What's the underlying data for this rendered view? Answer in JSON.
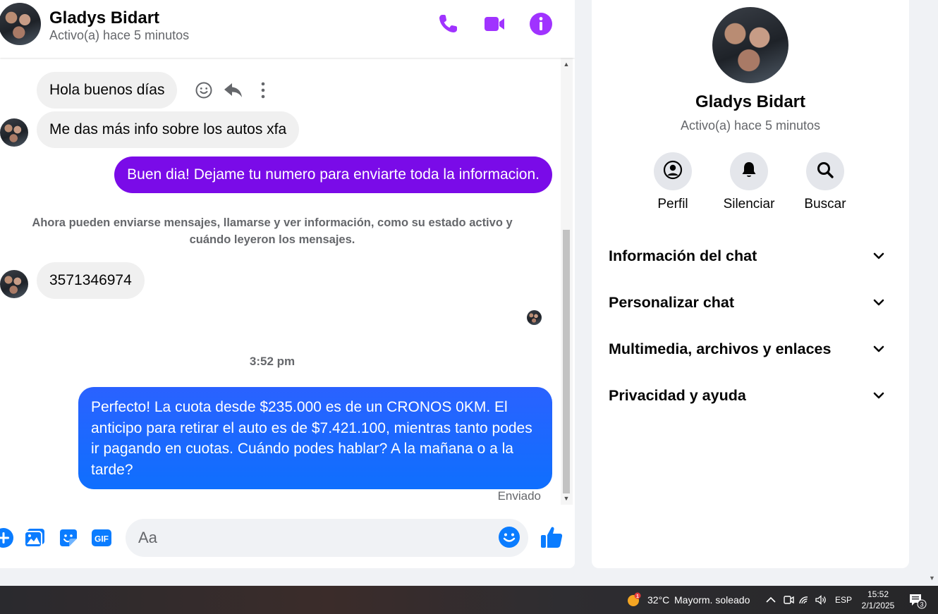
{
  "header": {
    "name": "Gladys Bidart",
    "status": "Activo(a) hace 5 minutos",
    "icons": [
      "phone-icon",
      "video-camera-icon",
      "info-icon"
    ]
  },
  "messages": [
    {
      "id": "m1",
      "direction": "incoming",
      "text": "Hola buenos días"
    },
    {
      "id": "m2",
      "direction": "incoming",
      "text": "Me das más info sobre los autos xfa"
    },
    {
      "id": "m3",
      "direction": "outgoing",
      "text": "Buen dia! Dejame tu numero para enviarte toda la informacion."
    },
    {
      "id": "m4",
      "direction": "incoming",
      "text": "3571346974"
    },
    {
      "id": "m5",
      "direction": "outgoing",
      "text": "Perfecto! La cuota desde $235.000 es de un CRONOS 0KM. El anticipo para retirar el auto es de $7.421.100, mientras tanto podes ir pagando en cuotas. Cuándo podes hablar? A la mañana o a la tarde?"
    }
  ],
  "system_note": "Ahora pueden enviarse mensajes, llamarse y ver información, como su estado activo y cuándo leyeron los mensajes.",
  "time_separator": "3:52 pm",
  "sent_status": "Enviado",
  "composer": {
    "placeholder": "Aa",
    "icons": [
      "plus-icon",
      "image-icon",
      "sticker-icon",
      "gif-icon",
      "emoji-icon",
      "thumbs-up-icon"
    ],
    "gif_label": "GIF"
  },
  "info_panel": {
    "name": "Gladys Bidart",
    "status": "Activo(a) hace 5 minutos",
    "actions": [
      {
        "label": "Perfil",
        "icon": "profile-icon"
      },
      {
        "label": "Silenciar",
        "icon": "bell-icon"
      },
      {
        "label": "Buscar",
        "icon": "search-icon"
      }
    ],
    "sections": [
      {
        "label": "Información del chat"
      },
      {
        "label": "Personalizar chat"
      },
      {
        "label": "Multimedia, archivos y enlaces"
      },
      {
        "label": "Privacidad y ayuda"
      }
    ]
  },
  "taskbar": {
    "weather_badge": "1",
    "temperature": "32°C",
    "condition": "Mayorm. soleado",
    "language": "ESP",
    "time": "15:52",
    "date": "2/1/2025",
    "notification_count": "3"
  },
  "colors": {
    "accent": "#a033ff",
    "purple_bubble": "#7a0be8",
    "blue_bubble": "#0f6ffe",
    "incoming_bubble": "#f0f0f0",
    "icon_blue": "#0a7cff"
  }
}
